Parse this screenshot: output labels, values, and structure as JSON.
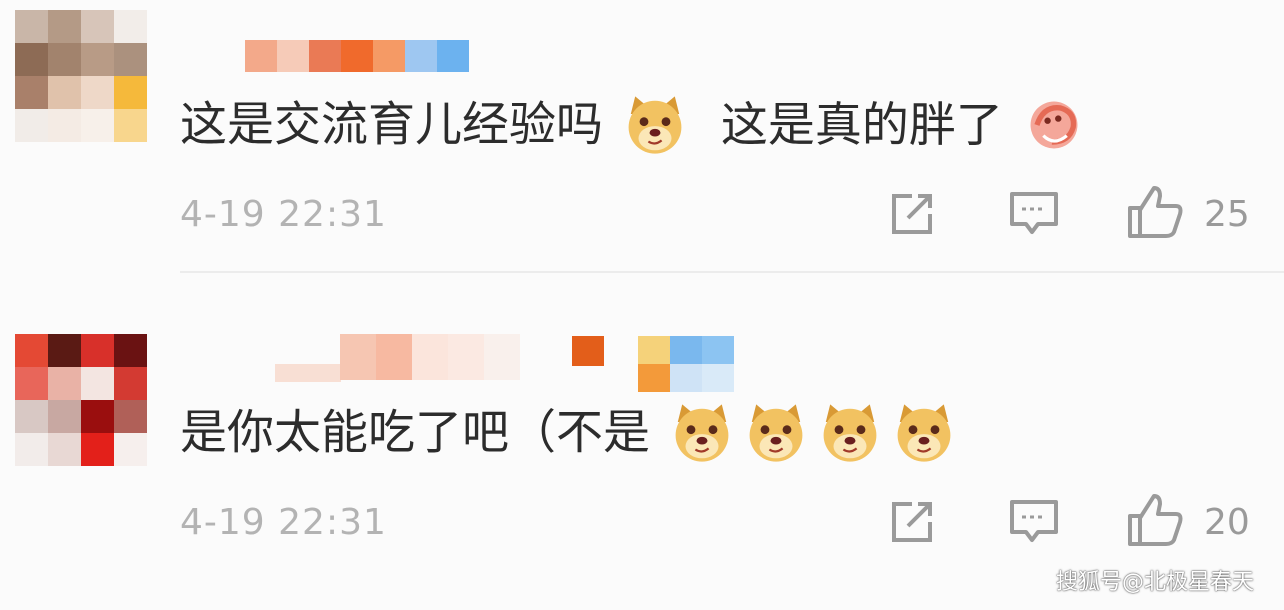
{
  "comments": [
    {
      "text_part1": "这是交流育儿经验吗",
      "emoji1": "doge-emoji",
      "text_part2": "这是真的胖了",
      "emoji2": "shrimp-sticker-emoji",
      "timestamp": "4-19 22:31",
      "like_count": "25"
    },
    {
      "text_part1": "是你太能吃了吧（不是",
      "emoji": "doge-emoji",
      "emoji_count": 4,
      "timestamp": "4-19 22:31",
      "like_count": "20"
    }
  ],
  "actions": {
    "share_icon": "share-icon",
    "reply_icon": "comment-icon",
    "like_icon": "thumbs-up-icon"
  },
  "watermark": "搜狐号@北极星春天",
  "colors": {
    "text": "#2c2c2c",
    "meta": "#b3b3b3",
    "icon": "#9a9a9a",
    "background": "#fbfbfb"
  }
}
